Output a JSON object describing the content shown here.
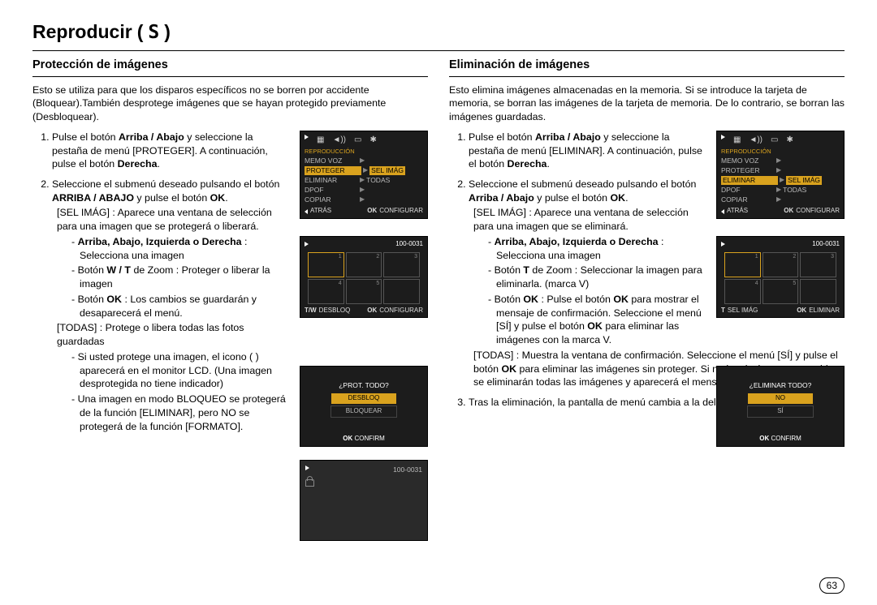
{
  "page_title_main": "Reproducir",
  "page_title_paren_open": "(",
  "page_title_icon_name": "S",
  "page_title_paren_close": ")",
  "page_number": "63",
  "left": {
    "heading": "Protección de imágenes",
    "intro": "Esto se utiliza para que los disparos específicos no se borren por accidente (Bloquear).También desprotege imágenes que se hayan protegido previamente (Desbloquear).",
    "step1_a": "Pulse el botón ",
    "step1_b": "Arriba / Abajo",
    "step1_c": " y seleccione la pestaña de menú [PROTEGER]. A continuación, pulse el botón ",
    "step1_d": "Derecha",
    "step1_e": ".",
    "step2_a": "Seleccione el submenú deseado pulsando el botón ",
    "step2_b": "ARRIBA / ABAJO",
    "step2_c": " y pulse el botón ",
    "step2_d": "OK",
    "step2_e": ".",
    "selimag": "[SEL IMÁG] : Aparece una ventana de selección para una imagen que se protegerá o liberará.",
    "b_arrows_lbl": "Arriba, Abajo, Izquierda o Derecha",
    "b_arrows_txt": " : Selecciona una imagen",
    "b_wt_a": "Botón ",
    "b_wt_b": "W / T",
    "b_wt_c": " de Zoom : Proteger o liberar la imagen",
    "b_ok_a": "Botón ",
    "b_ok_b": "OK",
    "b_ok_c": " : Los cambios se guardarán y desaparecerá el menú.",
    "todas": "[TODAS] : Protege o libera todas las fotos guardadas",
    "b_lock": "Si usted protege una imagen, el icono (      ) aparecerá en el monitor LCD. (Una imagen desprotegida no tiene indicador)",
    "b_bloqueo": "Una imagen en modo BLOQUEO se protegerá de la función [ELIMINAR], pero NO se protegerá de la función [FORMATO].",
    "panel1": {
      "tabs_row": "reproduccion-tabs",
      "h": "REPRODUCCIÓN",
      "rows": [
        {
          "l": "MEMO VOZ",
          "v": "",
          "sel": false
        },
        {
          "l": "PROTEGER",
          "v": "SEL IMÁG",
          "sel": true
        },
        {
          "l": "ELIMINAR",
          "v": "TODAS",
          "sel": false
        },
        {
          "l": "DPOF",
          "v": "",
          "sel": false
        },
        {
          "l": "COPIAR",
          "v": "",
          "sel": false
        }
      ],
      "back": "ATRÁS",
      "ok": "OK",
      "conf": "CONFIGURAR"
    },
    "panel2": {
      "counter": "100-0031",
      "tw": "T/W",
      "twlbl": "DESBLOQ",
      "ok": "OK",
      "conf": "CONFIGURAR"
    },
    "panel3": {
      "q": "¿PROT. TODO?",
      "o1": "DESBLOQ",
      "o2": "BLOQUEAR",
      "ok": "OK",
      "conf": "CONFIRM"
    },
    "panel4": {
      "counter": "100-0031"
    }
  },
  "right": {
    "heading": "Eliminación de imágenes",
    "intro": "Esto elimina imágenes almacenadas en la memoria. Si se introduce la tarjeta de memoria, se borran las imágenes de la tarjeta de memoria. De lo contrario, se borran las imágenes guardadas.",
    "step1_a": "Pulse el botón ",
    "step1_b": "Arriba / Abajo",
    "step1_c": " y seleccione la pestaña de menú [ELIMINAR]. A continuación, pulse el botón ",
    "step1_d": "Derecha",
    "step1_e": ".",
    "step2_a": "Seleccione el submenú deseado pulsando el botón ",
    "step2_b": "Arriba / Abajo",
    "step2_c": " y pulse el botón ",
    "step2_d": "OK",
    "step2_e": ".",
    "selimag": "[SEL IMÁG] : Aparece una ventana de selección para una imagen que se eliminará.",
    "b_arrows_lbl": "Arriba, Abajo, Izquierda o Derecha",
    "b_arrows_txt": " : Selecciona una imagen",
    "b_t_a": "Botón ",
    "b_t_b": "T",
    "b_t_c": " de Zoom : Seleccionar la imagen para eliminarla. (marca V)",
    "b_ok_a": "Botón ",
    "b_ok_b": "OK",
    "b_ok_c": " : Pulse el botón ",
    "b_ok_d": "OK",
    "b_ok_e": " para mostrar el mensaje de confirmación. Seleccione el menú [SÍ] y pulse el botón ",
    "b_ok_f": "OK",
    "b_ok_g": " para eliminar las imágenes con la marca V.",
    "todas_a": "[TODAS] : Muestra la ventana de confirmación. Seleccione el menú [SÍ] y pulse el botón ",
    "todas_b": "OK",
    "todas_c": " para eliminar las imágenes sin proteger. Si no hay imágenes protegidas, se eliminarán todas las imágenes y aparecerá el mensaje [¡NO HAY IMAGEN!].",
    "step3": "Tras la eliminación, la pantalla de menú cambia a la del modo de reproducción.",
    "panel1": {
      "h": "REPRODUCCIÓN",
      "rows": [
        {
          "l": "MEMO VOZ",
          "v": "",
          "sel": false
        },
        {
          "l": "PROTEGER",
          "v": "",
          "sel": false
        },
        {
          "l": "ELIMINAR",
          "v": "SEL IMÁG",
          "sel": true
        },
        {
          "l": "DPOF",
          "v": "TODAS",
          "sel": false
        },
        {
          "l": "COPIAR",
          "v": "",
          "sel": false
        }
      ],
      "back": "ATRÁS",
      "ok": "OK",
      "conf": "CONFIGURAR"
    },
    "panel2": {
      "counter": "100-0031",
      "t": "T",
      "tlbl": "SEL IMÁG",
      "ok": "OK",
      "conf": "ELIMINAR"
    },
    "panel3": {
      "q": "¿ELIMINAR TODO?",
      "o1": "NO",
      "o2": "SÍ",
      "ok": "OK",
      "conf": "CONFIRM"
    }
  }
}
